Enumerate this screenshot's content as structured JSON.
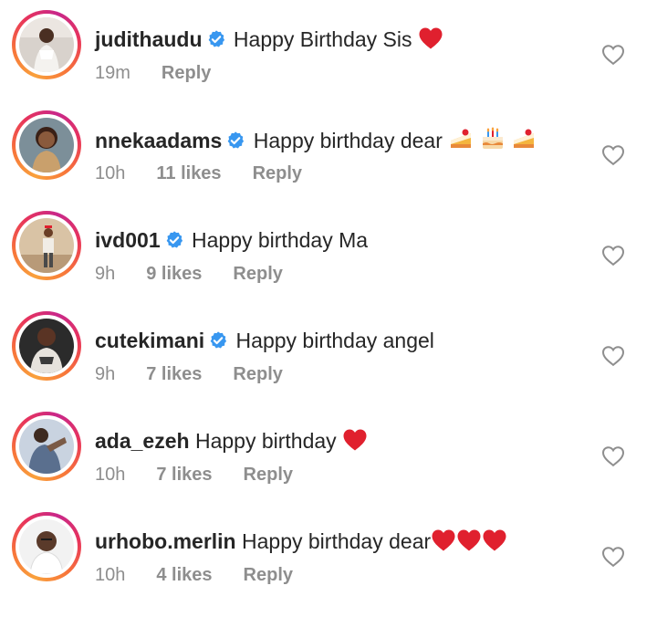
{
  "comments": [
    {
      "username": "judithaudu",
      "verified": true,
      "text": "Happy Birthday Sis",
      "emojis": [
        "red-heart"
      ],
      "time": "19m",
      "likes": "",
      "reply": "Reply"
    },
    {
      "username": "nnekaadams",
      "verified": true,
      "text": "Happy birthday dear",
      "emojis": [
        "shortcake",
        "birthday-cake",
        "shortcake"
      ],
      "time": "10h",
      "likes": "11 likes",
      "reply": "Reply"
    },
    {
      "username": "ivd001",
      "verified": true,
      "text": "Happy birthday Ma",
      "emojis": [],
      "time": "9h",
      "likes": "9 likes",
      "reply": "Reply"
    },
    {
      "username": "cutekimani",
      "verified": true,
      "text": "Happy birthday angel",
      "emojis": [],
      "time": "9h",
      "likes": "7 likes",
      "reply": "Reply"
    },
    {
      "username": "ada_ezeh",
      "verified": false,
      "text": "Happy birthday",
      "emojis": [
        "red-heart"
      ],
      "time": "10h",
      "likes": "7 likes",
      "reply": "Reply"
    },
    {
      "username": "urhobo.merlin",
      "verified": false,
      "text": "Happy birthday dear",
      "emojis": [
        "red-heart",
        "red-heart",
        "red-heart"
      ],
      "time": "10h",
      "likes": "4 likes",
      "reply": "Reply"
    }
  ],
  "colors": {
    "text": "#262626",
    "meta": "#8e8e8e",
    "verified": "#3897f0",
    "heart": "#e0202e",
    "like_outline": "#8e8e8e"
  },
  "icons": {
    "verified": "verified-badge-icon",
    "like": "heart-outline-icon"
  }
}
